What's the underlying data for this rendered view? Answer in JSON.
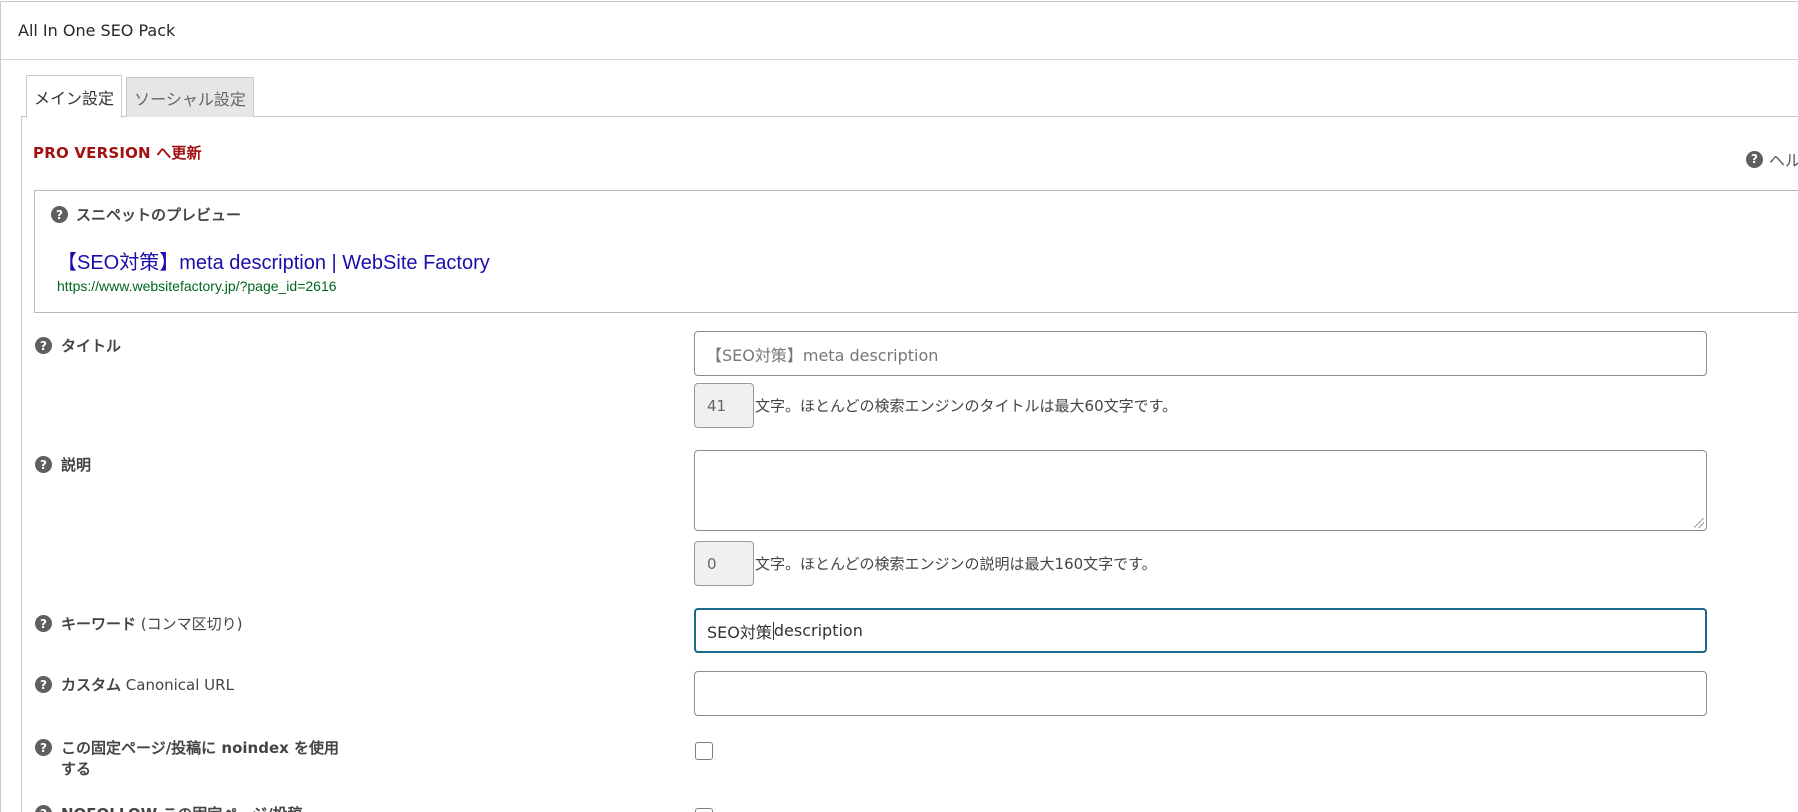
{
  "metabox": {
    "title": "All In One SEO Pack"
  },
  "tabs": [
    {
      "label": "メイン設定",
      "active": true
    },
    {
      "label": "ソーシャル設定",
      "active": false
    }
  ],
  "pro_link": "PRO VERSION へ更新",
  "help_toggle": "ヘル",
  "snippet": {
    "label": "スニペットのプレビュー",
    "title": "【SEO対策】meta description | WebSite Factory",
    "url": "https://www.websitefactory.jp/?page_id=2616"
  },
  "fields": {
    "title": {
      "label": "タイトル",
      "placeholder": "【SEO対策】meta description",
      "count": "41",
      "count_help": "文字。ほとんどの検索エンジンのタイトルは最大60文字です。"
    },
    "description": {
      "label": "説明",
      "value": "",
      "count": "0",
      "count_help": "文字。ほとんどの検索エンジンの説明は最大160文字です。"
    },
    "keywords": {
      "label_main": "キーワード",
      "label_sub": " (コンマ区切り)",
      "value_before_caret": "SEO対策",
      "value_after_caret": "description"
    },
    "canonical": {
      "label_main": "カスタム",
      "label_sub": " Canonical URL",
      "value": ""
    },
    "noindex": {
      "label_line1": "この固定ページ/投稿に noindex を使用",
      "label_line2": "する",
      "checked": false
    },
    "nofollow": {
      "label_line1": "NOFOLLOW この固定ページ/投稿",
      "checked": false
    }
  },
  "colors": {
    "pro_link": "#a11111",
    "snippet_title": "#1a0dab",
    "snippet_url": "#006621",
    "focus_border": "#1b6a8c"
  }
}
